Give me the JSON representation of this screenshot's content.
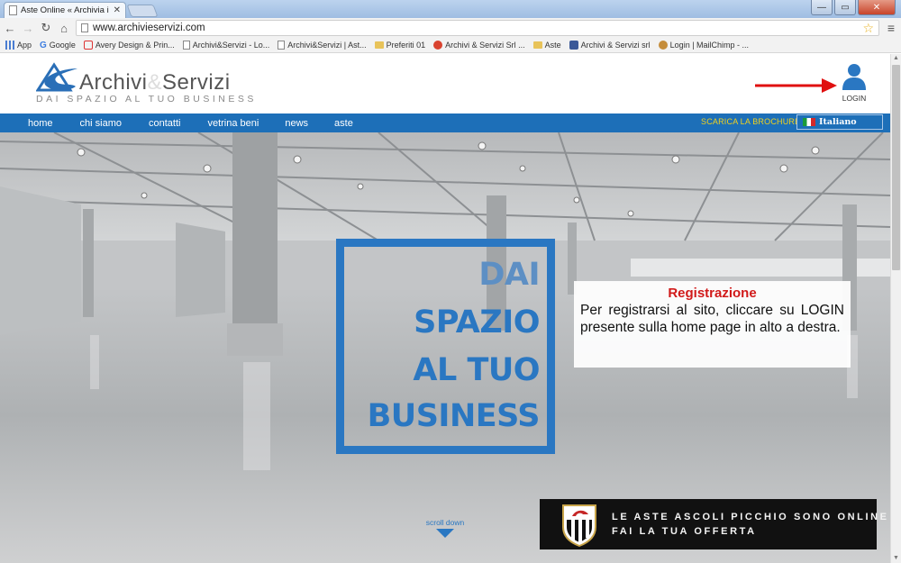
{
  "browser": {
    "tab_title": "Aste Online « Archivia i tu",
    "tab_close": "✕",
    "url": "www.archivieservizi.com",
    "window_buttons": [
      "—",
      "▭",
      "✕"
    ],
    "bookmarks": [
      {
        "label": "App",
        "icon": "apps-icon"
      },
      {
        "label": "Google",
        "icon": "google-icon"
      },
      {
        "label": "Avery Design & Prin...",
        "icon": "avery-icon"
      },
      {
        "label": "Archivi&Servizi - Lo...",
        "icon": "page-icon"
      },
      {
        "label": "Archivi&Servizi | Ast...",
        "icon": "page-icon"
      },
      {
        "label": "Preferiti 01",
        "icon": "folder-icon"
      },
      {
        "label": "Archivi & Servizi Srl ...",
        "icon": "google-plus-icon"
      },
      {
        "label": "Aste",
        "icon": "folder-icon"
      },
      {
        "label": "Archivi & Servizi srl",
        "icon": "facebook-icon"
      },
      {
        "label": "Login | MailChimp - ...",
        "icon": "mailchimp-icon"
      }
    ]
  },
  "site": {
    "logo_name_left": "Archivi",
    "logo_amp": "&",
    "logo_name_right": "Servizi",
    "logo_tagline": "DAI SPAZIO AL TUO BUSINESS",
    "login_label": "LOGIN",
    "nav": [
      "home",
      "chi siamo",
      "contatti",
      "vetrina beni",
      "news",
      "aste"
    ],
    "brochure_label": "SCARICA LA BROCHURE",
    "language": "Italiano"
  },
  "hero": {
    "slogan": [
      "DAI",
      "SPAZIO",
      "AL TUO",
      "BUSINESS"
    ],
    "info_title": "Registrazione",
    "info_text": "Per registrarsi al sito, cliccare su LOGIN presente sulla home page in alto a destra.",
    "scroll_label": "scroll down",
    "promo_line1": "LE ASTE ASCOLI PICCHIO SONO ONLINE",
    "promo_line2": "FAI LA TUA OFFERTA"
  },
  "colors": {
    "brand_blue": "#1d6fb8",
    "slogan_blue": "#2a77c2",
    "info_title_red": "#d11a1a",
    "brochure_yellow": "#f3d21b",
    "annotation_arrow_red": "#e01010"
  }
}
